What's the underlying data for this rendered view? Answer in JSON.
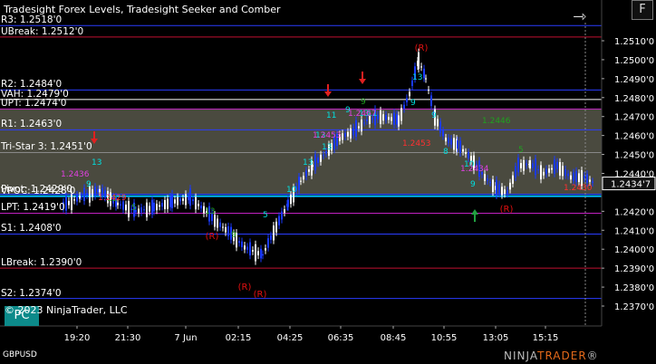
{
  "window": {
    "title": "Tradesight Forex Levels, Tradesight Seeker and Comber",
    "f_button": "F",
    "pc_button": "PC",
    "copyright": "© 2023 NinjaTrader, LLC",
    "symbol": "GBPUSD",
    "logo_left": "NINJA",
    "logo_right": "TRADER",
    "logo_mark": "®"
  },
  "level_labels": [
    {
      "text": "R3: 1.2518'0",
      "price": 1.2518
    },
    {
      "text": "UBreak: 1.2512'0",
      "price": 1.2512
    },
    {
      "text": "R2: 1.2484'0",
      "price": 1.2484
    },
    {
      "text": "VAH: 1.2479'0",
      "price": 1.2479
    },
    {
      "text": "UPT: 1.2474'0",
      "price": 1.2474
    },
    {
      "text": "R1: 1.2463'0",
      "price": 1.2463
    },
    {
      "text": "Tri-Star 3: 1.2451'0",
      "price": 1.2451
    },
    {
      "text": "Pivot: 1.2429'0",
      "price": 1.2429
    },
    {
      "text": "VPOC: 1.2428'0",
      "price": 1.2428
    },
    {
      "text": "LPT: 1.2419'0",
      "price": 1.2419
    },
    {
      "text": "S1: 1.2408'0",
      "price": 1.2408
    },
    {
      "text": "LBreak: 1.2390'0",
      "price": 1.239
    },
    {
      "text": "S2: 1.2374'0",
      "price": 1.2374
    }
  ],
  "price_axis": {
    "ticks": [
      "1.2510'0",
      "1.2500'0",
      "1.2490'0",
      "1.2480'0",
      "1.2470'0",
      "1.2460'0",
      "1.2450'0",
      "1.2440'0",
      "1.2420'0",
      "1.2410'0",
      "1.2400'0",
      "1.2390'0",
      "1.2380'0",
      "1.2370'0"
    ],
    "current_price": "1.2434'7",
    "current_value": 1.24347
  },
  "time_axis": {
    "ticks": [
      "19:20",
      "21:30",
      "7 Jun",
      "02:15",
      "04:25",
      "06:35",
      "08:45",
      "10:55",
      "13:05",
      "15:15"
    ]
  },
  "annotations": {
    "reversal": "(R)",
    "seeker_labels": [
      "13",
      "9",
      "12",
      "5",
      "13",
      "9",
      "5",
      "10",
      "13",
      "11",
      "13",
      "13",
      "9",
      "13",
      "9",
      "11",
      "13",
      "9",
      "9",
      "8",
      "10",
      "9",
      "5"
    ],
    "price_tags": [
      {
        "text": "1.2436",
        "color": "#e040e0"
      },
      {
        "text": "1.2429",
        "color": "#ff3030"
      },
      {
        "text": "1.2453",
        "color": "#e040e0"
      },
      {
        "text": "1.2467",
        "color": "#e040e0"
      },
      {
        "text": "1.2453",
        "color": "#ff3030"
      },
      {
        "text": "1.2446",
        "color": "#20a020"
      },
      {
        "text": "1.2434",
        "color": "#e040e0"
      },
      {
        "text": "1.2430",
        "color": "#ff3030"
      }
    ]
  },
  "colors": {
    "background": "#000000",
    "value_area": "#4a4a3f",
    "up_candle": "#ffffff",
    "down_candle": "#1a3aff",
    "reversal": "#e01010",
    "cyan_count": "#00e0e0",
    "green_count": "#20a020",
    "accent_pc": "#0c8a8a"
  }
}
